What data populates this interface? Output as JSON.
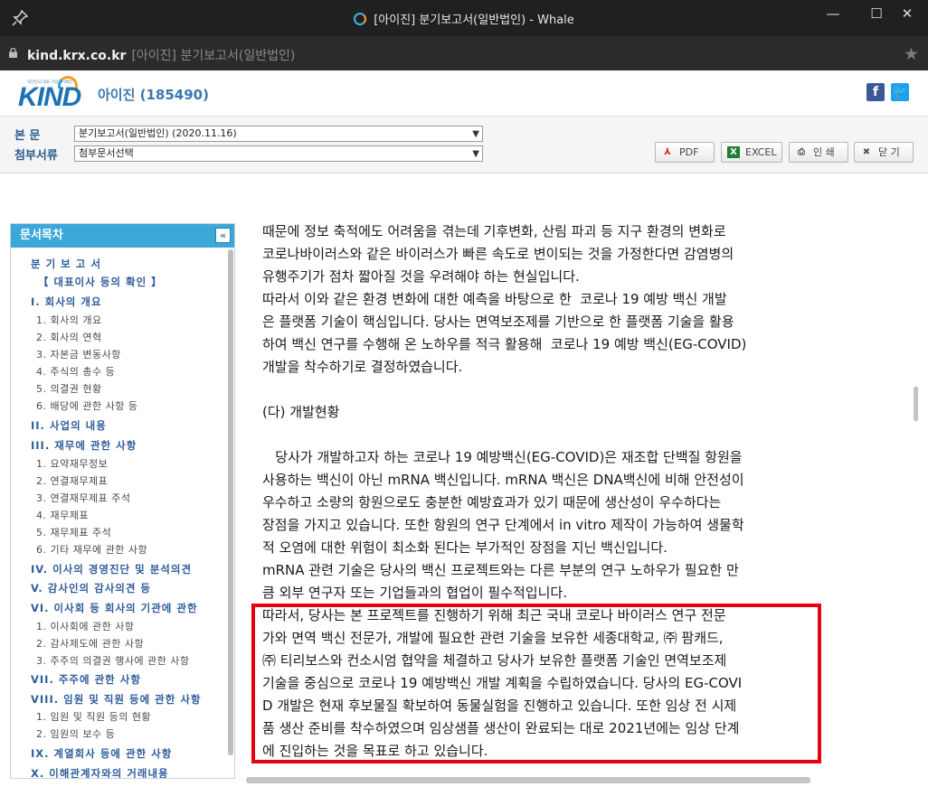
{
  "window": {
    "title": "[아이진] 분기보고서(일반법인) - Whale"
  },
  "address": {
    "host": "kind.krx.co.kr",
    "page_title": "[아이진] 분기보고서(일반법인)"
  },
  "header": {
    "logo_small": "대한민국 대표 기업공시채널",
    "logo_big": "KIND",
    "company": "아이진 (185490)"
  },
  "toolbar": {
    "main_label": "본 문",
    "main_value": "분기보고서(일반법인) (2020.11.16)",
    "attach_label": "첨부서류",
    "attach_value": "첨부문서선택",
    "pdf": "PDF",
    "excel": "EXCEL",
    "print": "인 쇄",
    "close": "닫 기"
  },
  "toc": {
    "title": "문서목차",
    "collapse": "«",
    "items": [
      {
        "text": "분 기 보 고 서",
        "level": "h"
      },
      {
        "text": "【 대표이사 등의 확인 】",
        "level": "h"
      },
      {
        "text": "I. 회사의 개요",
        "level": "h"
      },
      {
        "text": "1. 회사의 개요",
        "level": "s"
      },
      {
        "text": "2. 회사의 연혁",
        "level": "s"
      },
      {
        "text": "3. 자본금 변동사항",
        "level": "s"
      },
      {
        "text": "4. 주식의 총수 등",
        "level": "s"
      },
      {
        "text": "5. 의결권 현황",
        "level": "s"
      },
      {
        "text": "6. 배당에 관한 사항 등",
        "level": "s"
      },
      {
        "text": "II. 사업의 내용",
        "level": "h"
      },
      {
        "text": "III. 재무에 관한 사항",
        "level": "h"
      },
      {
        "text": "1. 요약재무정보",
        "level": "s"
      },
      {
        "text": "2. 연결재무제표",
        "level": "s"
      },
      {
        "text": "3. 연결재무제표 주석",
        "level": "s"
      },
      {
        "text": "4. 재무제표",
        "level": "s"
      },
      {
        "text": "5. 재무제표 주석",
        "level": "s"
      },
      {
        "text": "6. 기타 재무에 관한 사항",
        "level": "s"
      },
      {
        "text": "IV. 이사의 경영진단 및 분석의견",
        "level": "h"
      },
      {
        "text": "V. 감사인의 감사의견 등",
        "level": "h"
      },
      {
        "text": "VI. 이사회 등 회사의 기관에 관한",
        "level": "h"
      },
      {
        "text": "1. 이사회에 관한 사항",
        "level": "s"
      },
      {
        "text": "2. 감사제도에 관한 사항",
        "level": "s"
      },
      {
        "text": "3. 주주의 의결권 행사에 관한 사항",
        "level": "s"
      },
      {
        "text": "VII. 주주에 관한 사항",
        "level": "h"
      },
      {
        "text": "VIII. 임원 및 직원 등에 관한 사항",
        "level": "h"
      },
      {
        "text": "1. 임원 및 직원 등의 현황",
        "level": "s"
      },
      {
        "text": "2. 임원의 보수 등",
        "level": "s"
      },
      {
        "text": "IX. 계열회사 등에 관한 사항",
        "level": "h"
      },
      {
        "text": "X. 이해관계자와의 거래내용",
        "level": "h"
      }
    ]
  },
  "content": {
    "lines": [
      "때문에 정보 축적에도 어려움을 겪는데 기후변화, 산림 파괴 등 지구 환경의 변화로",
      "코로나바이러스와 같은 바이러스가 빠른 속도로 변이되는 것을 가정한다면 감염병의",
      "유행주기가 점차 짧아질 것을 우려해야 하는 현실입니다.",
      "따라서 이와 같은 환경 변화에 대한 예측을 바탕으로 한  코로나 19 예방 백신 개발",
      "은 플랫폼 기술이 핵심입니다. 당사는 면역보조제를 기반으로 한 플랫폼 기술을 활용",
      "하여 백신 연구를 수행해 온 노하우를 적극 활용해  코로나 19 예방 백신(EG-COVID)",
      "개발을 착수하기로 결정하였습니다.",
      "(다) 개발현황",
      "   당사가 개발하고자 하는 코로나 19 예방백신(EG-COVID)은 재조합 단백질 항원을",
      "사용하는 백신이 아닌 mRNA 백신입니다. mRNA 백신은 DNA백신에 비해 안전성이",
      "우수하고 소량의 항원으로도 충분한 예방효과가 있기 때문에 생산성이 우수하다는",
      "장점을 가지고 있습니다. 또한 항원의 연구 단계에서 in vitro 제작이 가능하여 생물학",
      "적 오염에 대한 위험이 최소화 된다는 부가적인 장점을 지닌 백신입니다.",
      "mRNA 관련 기술은 당사의 백신 프로젝트와는 다른 부분의 연구 노하우가 필요한 만",
      "큼 외부 연구자 또는 기업들과의 협업이 필수적입니다.",
      "따라서, 당사는 본 프로젝트를 진행하기 위해 최근 국내 코로나 바이러스 연구 전문",
      "가와 면역 백신 전문가, 개발에 필요한 관련 기술을 보유한 세종대학교, ㈜ 팜캐드,",
      "㈜ 티리보스와 컨소시엄 협약을 체결하고 당사가 보유한 플랫폼 기술인 면역보조제",
      "기술을 중심으로 코로나 19 예방백신 개발 계획을 수립하였습니다. 당사의 EG-COVI",
      "D 개발은 현재 후보물질 확보하여 동물실험을 진행하고 있습니다. 또한 임상 전 시제",
      "품 생산 준비를 착수하였으며 임상샘플 생산이 완료되는 대로 2021년에는 임상 단계",
      "에 진입하는 것을 목표로 하고 있습니다."
    ]
  }
}
